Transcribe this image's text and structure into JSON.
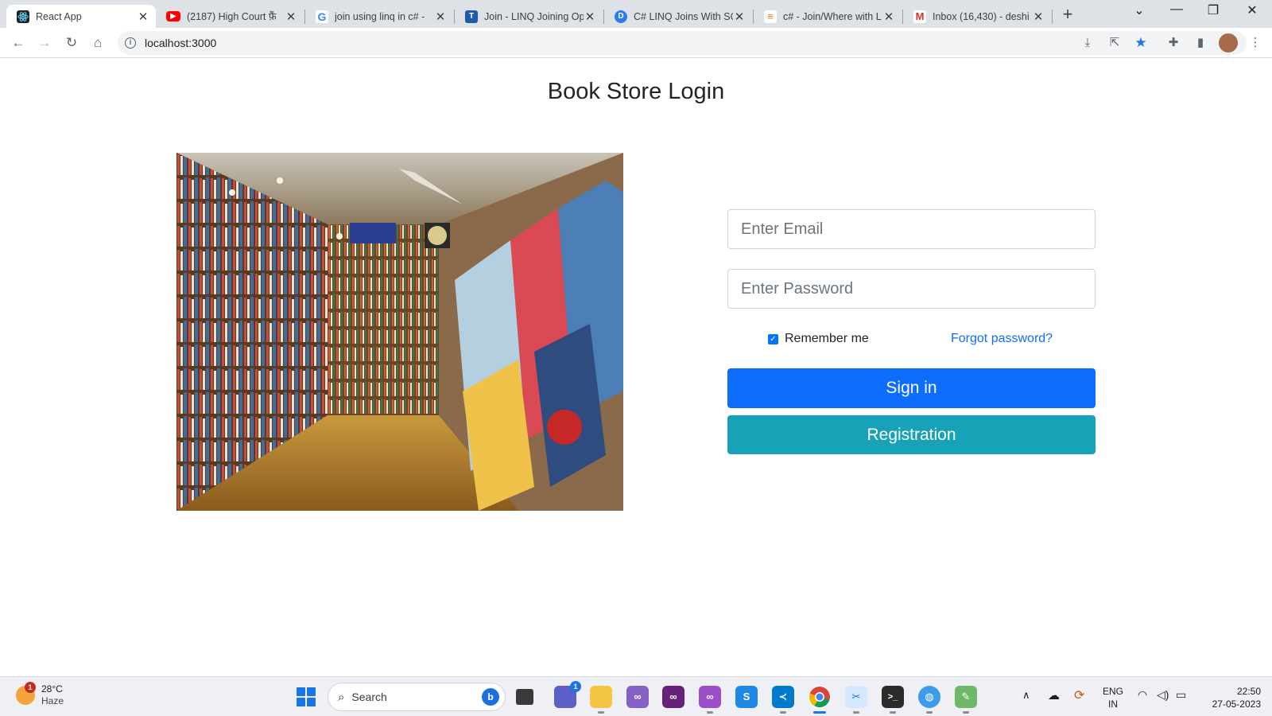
{
  "browser": {
    "tabs": [
      {
        "title": "React App",
        "icon": "react-icon",
        "color": "#20232a",
        "active": true
      },
      {
        "title": "(2187) High Court फ़ैं",
        "icon": "youtube-icon",
        "color": "#ff0000",
        "active": false
      },
      {
        "title": "join using linq in c# -",
        "icon": "google-icon",
        "color": "#4285f4",
        "active": false
      },
      {
        "title": "Join - LINQ Joining Op",
        "icon": "tutorialsteacher-icon",
        "color": "#1e5ba8",
        "active": false
      },
      {
        "title": "C# LINQ Joins With SQ",
        "icon": "docs-icon",
        "color": "#2b7de9",
        "active": false
      },
      {
        "title": "c# - Join/Where with L",
        "icon": "stackoverflow-icon",
        "color": "#f48024",
        "active": false
      },
      {
        "title": "Inbox (16,430) - deshi",
        "icon": "gmail-icon",
        "color": "#d93025",
        "active": false
      }
    ],
    "url": "localhost:3000"
  },
  "page": {
    "title": "Book Store Login",
    "email_placeholder": "Enter Email",
    "password_placeholder": "Enter Password",
    "remember_label": "Remember me",
    "remember_checked": true,
    "forgot_label": "Forgot password?",
    "signin_label": "Sign in",
    "register_label": "Registration",
    "colors": {
      "primary": "#0d6efd",
      "info": "#17a2b8",
      "link": "#0d6efd"
    }
  },
  "taskbar": {
    "weather": {
      "temp": "28°C",
      "desc": "Haze",
      "badge": "1"
    },
    "search_label": "Search",
    "chat_badge": "1",
    "lang": {
      "top": "ENG",
      "bottom": "IN"
    },
    "time": "22:50",
    "date": "27-05-2023"
  }
}
